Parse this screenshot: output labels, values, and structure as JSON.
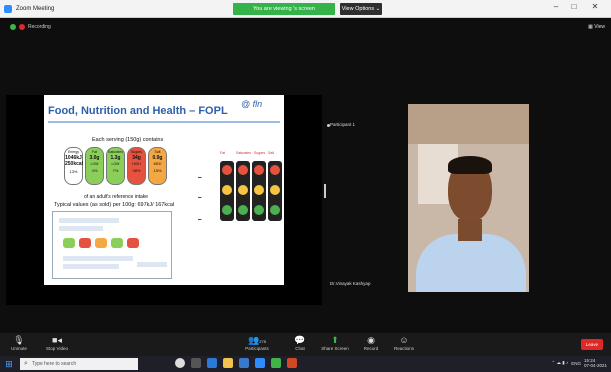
{
  "window": {
    "title": "Zoom Meeting",
    "share_banner": "You are viewing               's screen",
    "view_options": "View Options ⌄",
    "minimize": "–",
    "maximize": "□",
    "close": "✕"
  },
  "meeting": {
    "recording_label": "Recording",
    "view_label": "View"
  },
  "slide": {
    "title": "Food, Nutrition and Health – FOPL",
    "logo": "@ fln",
    "serving": "Each serving (150g) contains",
    "nutrients": [
      {
        "name": "Energy",
        "value": "1046kJ 250kcal",
        "level": "",
        "pct": "13%",
        "color": "#ffffff"
      },
      {
        "name": "Fat",
        "value": "3.0g",
        "level": "LOW",
        "pct": "4%",
        "color": "#8bcf5a"
      },
      {
        "name": "Saturates",
        "value": "1.3g",
        "level": "LOW",
        "pct": "7%",
        "color": "#8bcf5a"
      },
      {
        "name": "Sugars",
        "value": "34g",
        "level": "HIGH",
        "pct": "38%",
        "color": "#e5523d"
      },
      {
        "name": "Salt",
        "value": "0.9g",
        "level": "MED",
        "pct": "15%",
        "color": "#f4a742"
      }
    ],
    "reference": "of an adult's reference intake",
    "typical": "Typical values (as sold) per 100g: 697kJ/ 167kcal",
    "traffic_labels": [
      "Fat",
      "Saturates",
      "Sugars",
      "Salt"
    ]
  },
  "participants": [
    {
      "name": "Participant 1"
    },
    {
      "name": "Dr.Vinayak Kashyap"
    }
  ],
  "toolbar": {
    "mute": "Unmute",
    "video": "Stop Video",
    "participants": "Participants",
    "participants_count": "275",
    "chat": "Chat",
    "share": "Share Screen",
    "record": "Record",
    "reactions": "Reactions",
    "leave": "Leave"
  },
  "taskbar": {
    "search_placeholder": "Type here to search",
    "language": "ENG",
    "time": "15:24",
    "date": "07-04-2021"
  },
  "colors": {
    "accent_green": "#3fb549",
    "leave_red": "#e02828",
    "slide_title": "#2f5fa8"
  }
}
